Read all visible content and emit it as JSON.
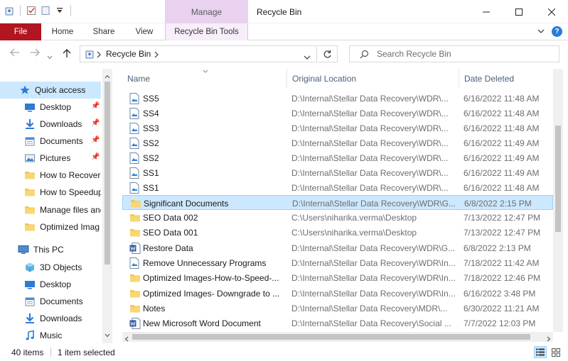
{
  "window": {
    "title": "Recycle Bin",
    "context_tab_group": "Manage"
  },
  "ribbon": {
    "tabs": [
      "File",
      "Home",
      "Share",
      "View",
      "Recycle Bin Tools"
    ]
  },
  "address": {
    "path": "Recycle Bin",
    "search_placeholder": "Search Recycle Bin"
  },
  "navigation": {
    "quick_access": "Quick access",
    "pinned": [
      {
        "label": "Desktop",
        "icon": "desktop-icon"
      },
      {
        "label": "Downloads",
        "icon": "downloads-icon"
      },
      {
        "label": "Documents",
        "icon": "documents-icon"
      },
      {
        "label": "Pictures",
        "icon": "pictures-icon"
      }
    ],
    "recent": [
      {
        "label": "How to Recover",
        "icon": "folder-icon"
      },
      {
        "label": "How to Speedup",
        "icon": "folder-icon"
      },
      {
        "label": "Manage files and",
        "icon": "folder-icon"
      },
      {
        "label": "Optimized Imag",
        "icon": "folder-icon"
      }
    ],
    "this_pc": "This PC",
    "pc_items": [
      {
        "label": "3D Objects",
        "icon": "3d-objects-icon"
      },
      {
        "label": "Desktop",
        "icon": "desktop-icon"
      },
      {
        "label": "Documents",
        "icon": "documents-icon"
      },
      {
        "label": "Downloads",
        "icon": "downloads-icon"
      },
      {
        "label": "Music",
        "icon": "music-icon"
      }
    ]
  },
  "columns": {
    "name": "Name",
    "original_location": "Original Location",
    "date_deleted": "Date Deleted"
  },
  "files": [
    {
      "name": "SS5",
      "type": "image",
      "original_location": "D:\\Internal\\Stellar Data Recovery\\WDR\\...",
      "date_deleted": "6/16/2022 11:48 AM"
    },
    {
      "name": "SS4",
      "type": "image",
      "original_location": "D:\\Internal\\Stellar Data Recovery\\WDR\\...",
      "date_deleted": "6/16/2022 11:48 AM"
    },
    {
      "name": "SS3",
      "type": "image",
      "original_location": "D:\\Internal\\Stellar Data Recovery\\WDR\\...",
      "date_deleted": "6/16/2022 11:48 AM"
    },
    {
      "name": "SS2",
      "type": "image",
      "original_location": "D:\\Internal\\Stellar Data Recovery\\WDR\\...",
      "date_deleted": "6/16/2022 11:49 AM"
    },
    {
      "name": "SS2",
      "type": "image",
      "original_location": "D:\\Internal\\Stellar Data Recovery\\WDR\\...",
      "date_deleted": "6/16/2022 11:49 AM"
    },
    {
      "name": "SS1",
      "type": "image",
      "original_location": "D:\\Internal\\Stellar Data Recovery\\WDR\\...",
      "date_deleted": "6/16/2022 11:49 AM"
    },
    {
      "name": "SS1",
      "type": "image",
      "original_location": "D:\\Internal\\Stellar Data Recovery\\WDR\\...",
      "date_deleted": "6/16/2022 11:48 AM"
    },
    {
      "name": "Significant Documents",
      "type": "folder",
      "original_location": "D:\\Internal\\Stellar Data Recovery\\WDR\\G...",
      "date_deleted": "6/8/2022 2:15 PM",
      "selected": true
    },
    {
      "name": "SEO Data 002",
      "type": "folder",
      "original_location": "C:\\Users\\niharika.verma\\Desktop",
      "date_deleted": "7/13/2022 12:47 PM"
    },
    {
      "name": "SEO Data 001",
      "type": "folder",
      "original_location": "C:\\Users\\niharika.verma\\Desktop",
      "date_deleted": "7/13/2022 12:47 PM"
    },
    {
      "name": "Restore Data",
      "type": "word",
      "original_location": "D:\\Internal\\Stellar Data Recovery\\WDR\\G...",
      "date_deleted": "6/8/2022 2:13 PM"
    },
    {
      "name": "Remove Unnecessary Programs",
      "type": "image",
      "original_location": "D:\\Internal\\Stellar Data Recovery\\WDR\\In...",
      "date_deleted": "7/18/2022 11:42 AM"
    },
    {
      "name": "Optimized Images-How-to-Speed-...",
      "type": "folder",
      "original_location": "D:\\Internal\\Stellar Data Recovery\\WDR\\In...",
      "date_deleted": "7/18/2022 12:46 PM"
    },
    {
      "name": "Optimized Images- Downgrade to ...",
      "type": "folder",
      "original_location": "D:\\Internal\\Stellar Data Recovery\\WDR\\In...",
      "date_deleted": "6/16/2022 3:48 PM"
    },
    {
      "name": "Notes",
      "type": "folder",
      "original_location": "D:\\Internal\\Stellar Data Recovery\\MDR\\...",
      "date_deleted": "6/30/2022 11:21 AM"
    },
    {
      "name": "New Microsoft Word Document",
      "type": "word",
      "original_location": "D:\\Internal\\Stellar Data Recovery\\Social ...",
      "date_deleted": "7/7/2022 12:03 PM"
    }
  ],
  "status": {
    "item_count": "40 items",
    "selection": "1 item selected"
  },
  "colors": {
    "file_tab": "#b1151f",
    "manage_context": "#e8d2f0",
    "selection": "#cce8ff",
    "folder": "#f3c64b"
  }
}
